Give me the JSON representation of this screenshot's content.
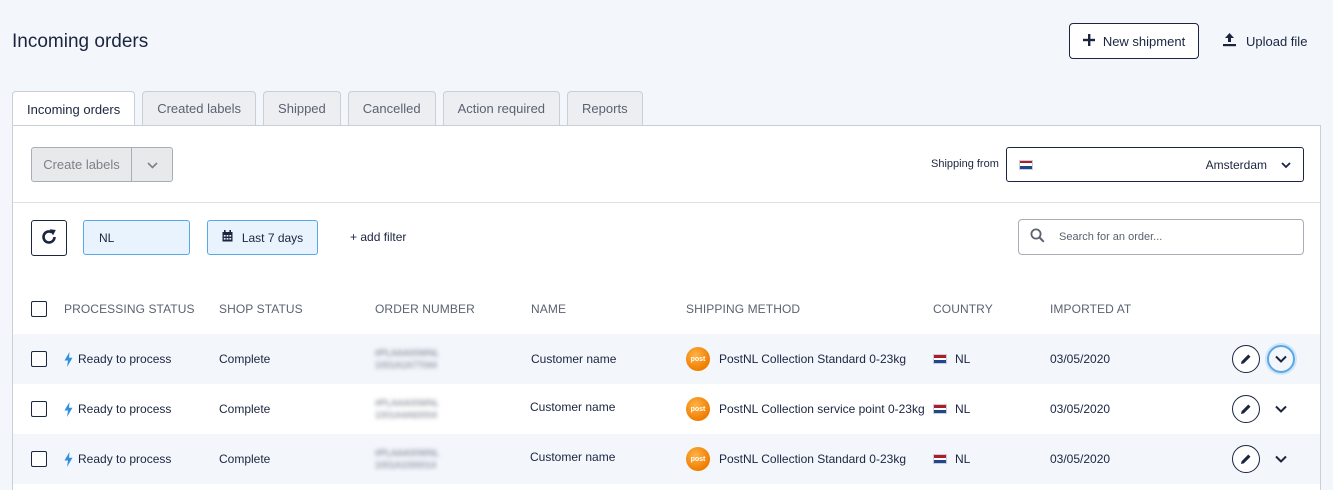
{
  "header": {
    "title": "Incoming orders",
    "new_shipment_label": "New shipment",
    "upload_label": "Upload file"
  },
  "tabs": [
    {
      "label": "Incoming orders",
      "active": true
    },
    {
      "label": "Created labels",
      "active": false
    },
    {
      "label": "Shipped",
      "active": false
    },
    {
      "label": "Cancelled",
      "active": false
    },
    {
      "label": "Action required",
      "active": false
    },
    {
      "label": "Reports",
      "active": false
    }
  ],
  "toolbar": {
    "create_labels_label": "Create labels",
    "shipping_from_label": "Shipping from",
    "shipping_from_value": "Amsterdam"
  },
  "filters": {
    "country_filter": "NL",
    "date_filter": "Last 7 days",
    "add_filter_label": "+ add filter",
    "search_placeholder": "Search for an order..."
  },
  "table": {
    "columns": {
      "processing_status": "PROCESSING STATUS",
      "shop_status": "SHOP STATUS",
      "order_number": "ORDER NUMBER",
      "name": "NAME",
      "shipping_method": "SHIPPING METHOD",
      "country": "COUNTRY",
      "imported_at": "IMPORTED AT"
    },
    "rows": [
      {
        "processing_status": "Ready to process",
        "shop_status": "Complete",
        "name": "Customer name",
        "shipping_method": "PostNL Collection Standard 0-23kg",
        "country": "NL",
        "imported_at": "03/05/2020"
      },
      {
        "processing_status": "Ready to process",
        "shop_status": "Complete",
        "name": "Customer name",
        "shipping_method": "PostNL Collection service point 0-23kg",
        "country": "NL",
        "imported_at": "03/05/2020"
      },
      {
        "processing_status": "Ready to process",
        "shop_status": "Complete",
        "name": "Customer name",
        "shipping_method": "PostNL Collection Standard 0-23kg",
        "country": "NL",
        "imported_at": "03/05/2020"
      }
    ]
  },
  "colors": {
    "primary": "#1b2540",
    "accent_blue": "#5aa7e6",
    "filter_bg": "#e8f3fd",
    "lightning": "#2f8fe0",
    "postnl_orange": "#ef7d00",
    "flag_red": "#ae1c28",
    "flag_blue": "#21468b"
  },
  "icons": {
    "new_shipment": "plus-icon",
    "upload": "upload-icon",
    "refresh": "refresh-icon",
    "calendar": "calendar-icon",
    "search": "search-icon",
    "status": "lightning-icon",
    "carrier": "postnl-logo",
    "edit": "pencil-icon",
    "expand": "chevron-down-icon"
  }
}
